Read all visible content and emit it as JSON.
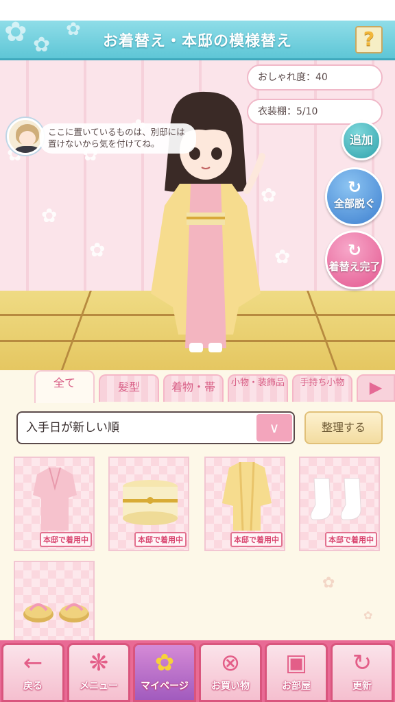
{
  "header": {
    "title": "お着替え・本邸の模様替え",
    "help_icon_label": "?"
  },
  "hint": {
    "text": "ここに置いているものは、別邸には置けないから気を付けてね。"
  },
  "stats": {
    "fashion": "おしゃれ度：40",
    "wardrobe": "衣装棚：5/10"
  },
  "actions": {
    "add": "追加",
    "undress_all": "全部脱ぐ",
    "finish": "着替え完了"
  },
  "tabs": [
    {
      "label": "全て"
    },
    {
      "label": "髪型"
    },
    {
      "label": "着物・帯"
    },
    {
      "label": "小物・装飾品"
    },
    {
      "label": "手持ち小物"
    }
  ],
  "sort": {
    "selected": "入手日が新しい順",
    "arrange_button": "整理する"
  },
  "items": [
    {
      "name": "pink-kimono",
      "badge": "本邸で着用中"
    },
    {
      "name": "yellow-obi",
      "badge": "本邸で着用中"
    },
    {
      "name": "yellow-haori",
      "badge": "本邸で着用中"
    },
    {
      "name": "white-tabi",
      "badge": "本邸で着用中"
    },
    {
      "name": "geta-sandals",
      "badge": ""
    }
  ],
  "nav": [
    {
      "label": "戻る",
      "icon": "back-arrow-icon"
    },
    {
      "label": "メニュー",
      "icon": "butterfly-icon"
    },
    {
      "label": "マイページ",
      "icon": "flower-icon"
    },
    {
      "label": "お買い物",
      "icon": "shopping-tag-icon"
    },
    {
      "label": "お部屋",
      "icon": "gift-icon"
    },
    {
      "label": "更新",
      "icon": "refresh-icon"
    }
  ],
  "colors": {
    "accent": "#e96a95",
    "header": "#5ec6d6",
    "add_button": "#2fa2ab",
    "undress_button": "#3d7fcf",
    "finish_button": "#e3578f"
  }
}
